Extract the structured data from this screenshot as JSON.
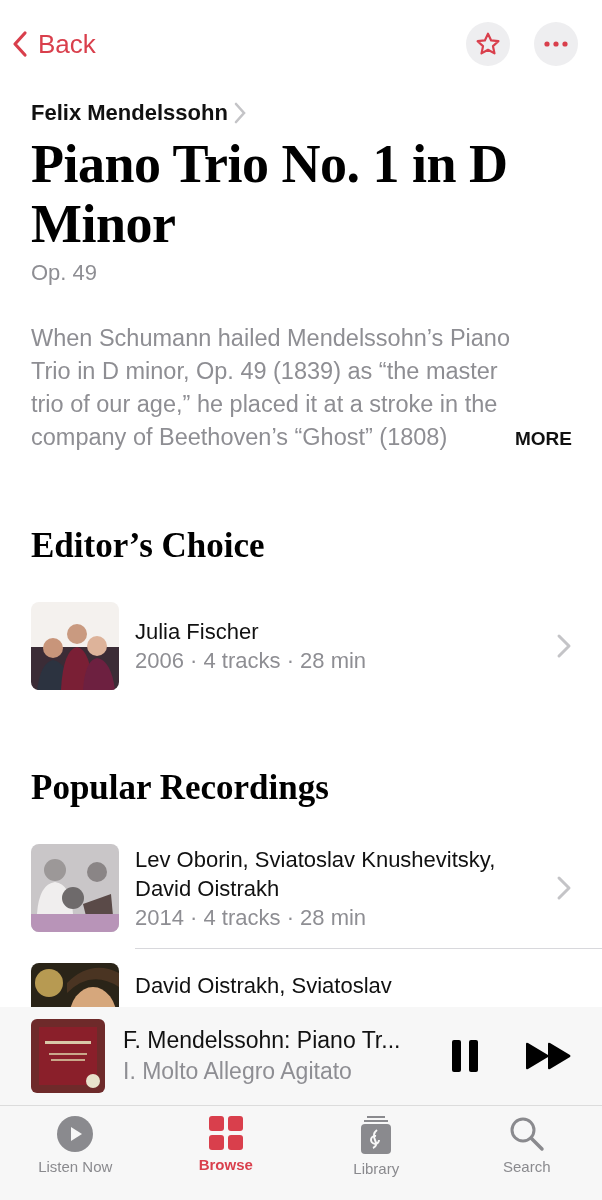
{
  "nav": {
    "back": "Back",
    "favorite": false
  },
  "composer": "Felix Mendelssohn",
  "title": "Piano Trio No. 1 in D Minor",
  "opus": "Op. 49",
  "description": "When Schumann hailed Mendelssohn’s Piano Trio in D minor, Op. 49 (1839) as “the master trio of our age,” he placed it at a stroke in the company of Beethoven’s “Ghost” (1808)",
  "more": "MORE",
  "sections": [
    {
      "heading": "Editor’s Choice",
      "items": [
        {
          "artist": "Julia Fischer",
          "details": "2006 · 4 tracks · 28 min"
        }
      ]
    },
    {
      "heading": "Popular Recordings",
      "items": [
        {
          "artist": "Lev Oborin, Sviatoslav Knushevitsky, David Oistrakh",
          "details": "2014 · 4 tracks · 28 min"
        },
        {
          "artist": "David Oistrakh, Sviatoslav"
        }
      ]
    }
  ],
  "now_playing": {
    "title": "F. Mendelssohn: Piano Tr...",
    "subtitle": "I. Molto Allegro Agitato",
    "playing": true
  },
  "tabs": [
    {
      "label": "Listen Now",
      "kind": "listen",
      "selected": false
    },
    {
      "label": "Browse",
      "kind": "browse",
      "selected": true
    },
    {
      "label": "Library",
      "kind": "library",
      "selected": false
    },
    {
      "label": "Search",
      "kind": "search",
      "selected": false
    }
  ]
}
